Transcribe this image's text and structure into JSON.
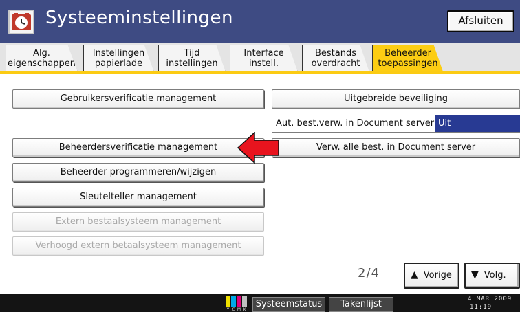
{
  "header": {
    "title": "Systeeminstellingen",
    "exit_label": "Afsluiten",
    "icon": "settings-clock-icon"
  },
  "tabs": [
    {
      "line1": "Alg.",
      "line2": "eigenschappen",
      "active": false
    },
    {
      "line1": "Instellingen",
      "line2": "papierlade",
      "active": false
    },
    {
      "line1": "Tijd",
      "line2": "instellingen",
      "active": false
    },
    {
      "line1": "Interface",
      "line2": "instell.",
      "active": false
    },
    {
      "line1": "Bestands",
      "line2": "overdracht",
      "active": false
    },
    {
      "line1": "Beheerder",
      "line2": "toepassingen",
      "active": true
    }
  ],
  "left_buttons": [
    {
      "label": "Gebruikersverificatie management",
      "enabled": true
    },
    {
      "label": "Beheerdersverificatie management",
      "enabled": true
    },
    {
      "label": "Beheerder programmeren/wijzigen",
      "enabled": true
    },
    {
      "label": "Sleutelteller management",
      "enabled": true
    },
    {
      "label": "Extern bestaalsysteem management",
      "enabled": false
    },
    {
      "label": "Verhoogd extern betaalsysteem management",
      "enabled": false
    }
  ],
  "right_buttons": [
    {
      "label": "Uitgebreide beveiliging"
    },
    {
      "label": "Verw. alle best. in Document server"
    }
  ],
  "setting": {
    "label": "Aut. best.verw. in Document server",
    "value": "Uit"
  },
  "pagination": {
    "indicator": "2/4",
    "prev_label": "Vorige",
    "next_label": "Volg."
  },
  "statusbar": {
    "status_label": "Systeemstatus",
    "jobs_label": "Takenlijst",
    "toner_labels": [
      "Y",
      "C",
      "M",
      "K"
    ],
    "toner_colors": [
      "#f0e000",
      "#00a8e8",
      "#e0007a",
      "#c0c0c0"
    ],
    "date": "4 MAR  2009",
    "time": "11:19"
  },
  "colors": {
    "header_bg": "#3e4b83",
    "active_tab": "#fccd13",
    "value_highlight": "#283a93",
    "annotation_arrow": "#e8141e"
  }
}
